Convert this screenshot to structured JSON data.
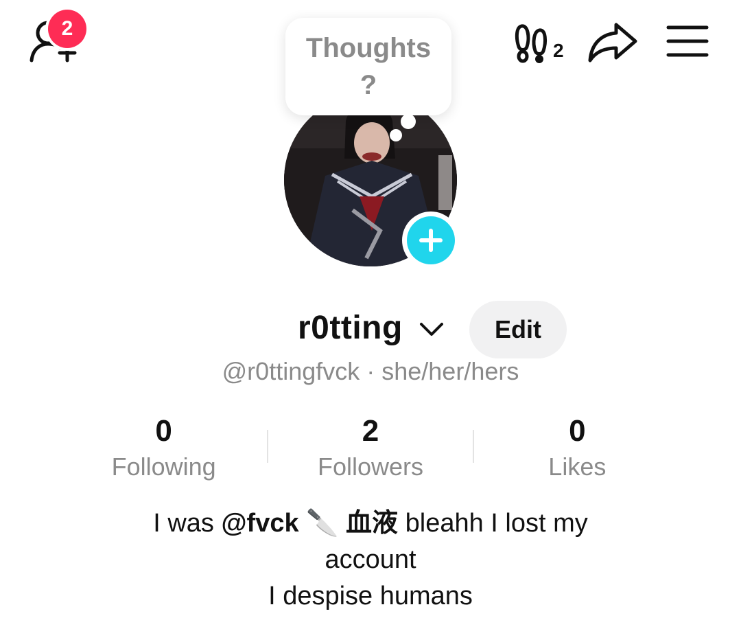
{
  "header": {
    "friend_request_count": "2",
    "profile_views_count": "2",
    "icons": {
      "add_friend": "person-plus-icon",
      "footprints": "footprints-icon",
      "share": "share-arrow-icon",
      "menu": "hamburger-menu-icon"
    }
  },
  "thoughts": {
    "text": "Thoughts\n?"
  },
  "profile": {
    "display_name": "r0tting",
    "edit_label": "Edit",
    "handle_line": "@r0ttingfvck · she/her/hers"
  },
  "stats": [
    {
      "value": "0",
      "label": "Following"
    },
    {
      "value": "2",
      "label": "Followers"
    },
    {
      "value": "0",
      "label": "Likes"
    }
  ],
  "bio": {
    "prefix": "I was ",
    "mention": "@fvck",
    "emoji": "🔪",
    "cjk": "血液",
    "suffix": " bleahh I lost my",
    "line2": "account",
    "line3": "I despise humans"
  },
  "colors": {
    "badge": "#fe2c55",
    "add_avatar": "#20d5ec",
    "muted_text": "#8a8a8a",
    "edit_bg": "#f1f1f2"
  }
}
